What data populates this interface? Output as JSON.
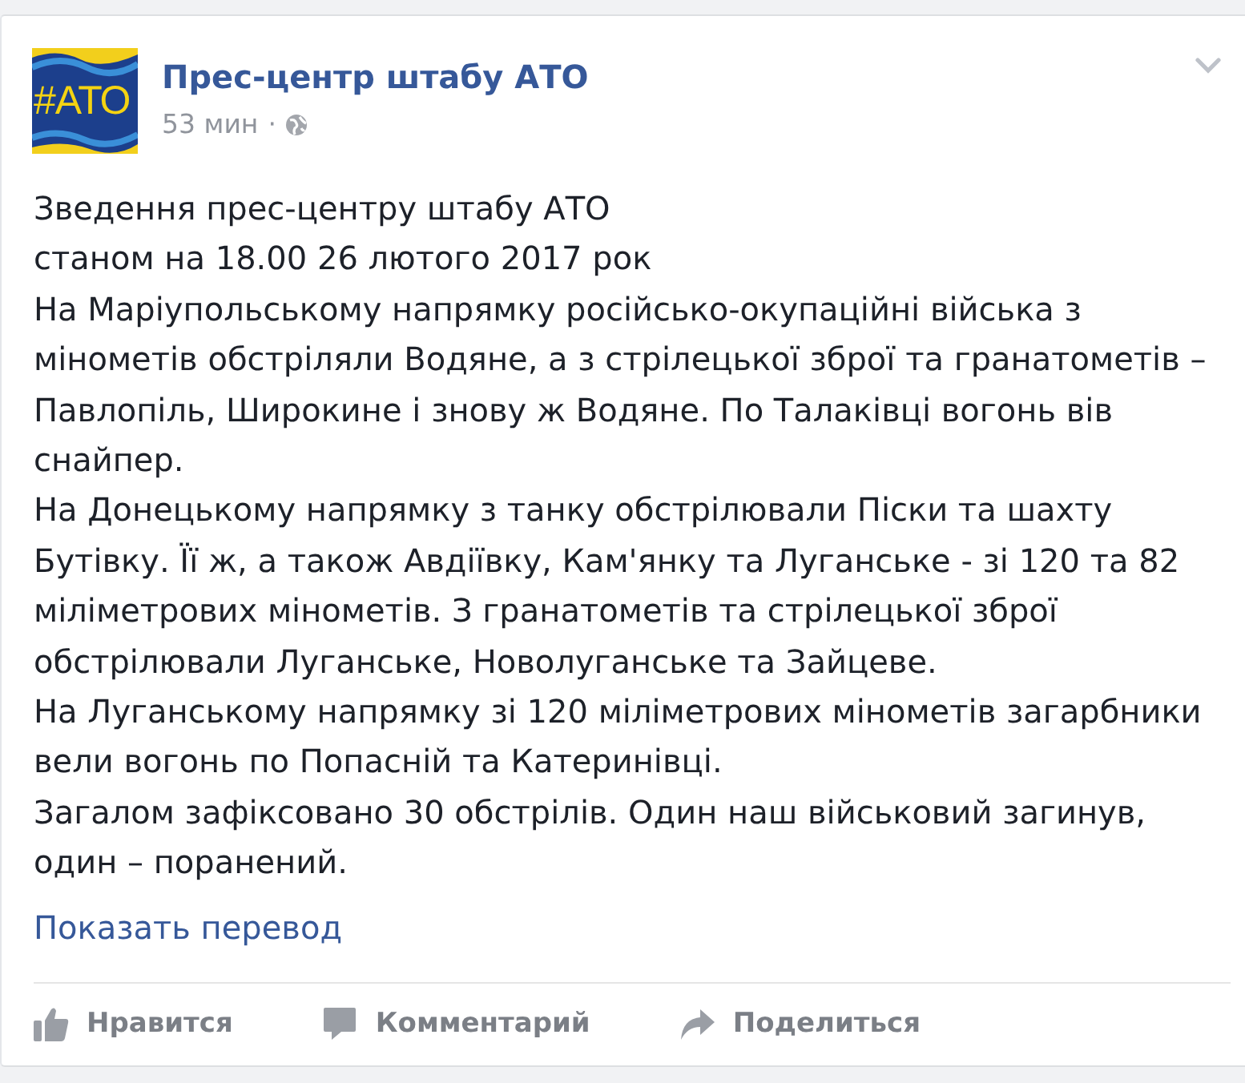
{
  "post": {
    "author": {
      "name": "Прес-центр штабу АТО",
      "avatar_text": "#АТО"
    },
    "time": "53 мин",
    "separator": "·",
    "paragraphs": [
      "Зведення прес-центру штабу АТО",
      "станом на 18.00 26 лютого 2017 рок",
      "На Маріупольському напрямку російсько-окупаційні війська з мінометів обстріляли Водяне, а з стрілецької зброї та гранатометів – Павлопіль, Широкине і знову ж Водяне. По Талаківці вогонь вів снайпер.",
      "На Донецькому напрямку з танку обстрілювали Піски та шахту Бутівку. Її ж, а також Авдіївку, Кам'янку та Луганське - зі 120 та 82 міліметрових мінометів. З гранатометів та стрілецької зброї обстрілювали Луганське, Новолуганське та Зайцеве.",
      "На Луганському напрямку зі 120 міліметрових мінометів загарбники вели вогонь по Попасній та Катеринівці.",
      "Загалом зафіксовано 30 обстрілів. Один наш військовий загинув, один – поранений."
    ],
    "translate_link": "Показать перевод",
    "actions": [
      {
        "kind": "like",
        "label": "Нравится"
      },
      {
        "kind": "comment",
        "label": "Комментарий"
      },
      {
        "kind": "share",
        "label": "Поделиться"
      }
    ]
  }
}
